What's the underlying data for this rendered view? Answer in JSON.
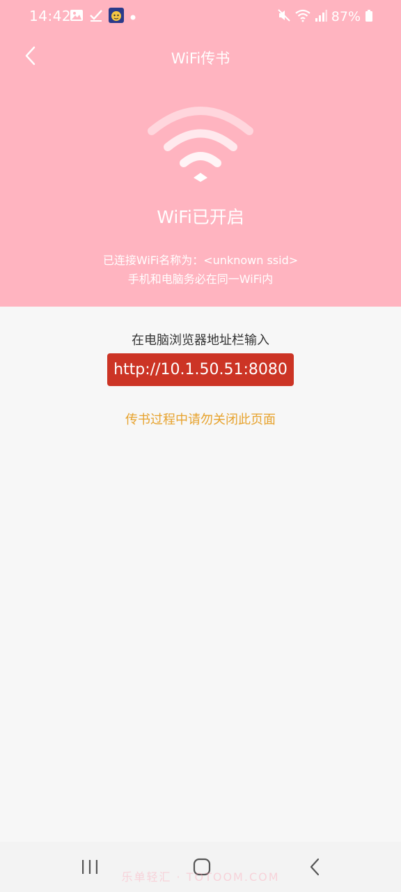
{
  "status_bar": {
    "time": "14:42",
    "battery": "87%",
    "left_icons": [
      "gallery-icon",
      "check-icon",
      "avatar-icon",
      "dot-icon"
    ],
    "right_icons": [
      "mute-icon",
      "wifi-icon",
      "signal-icon",
      "battery-icon"
    ]
  },
  "header": {
    "back_icon": "chevron-left-icon",
    "title": "WiFi传书"
  },
  "wifi_panel": {
    "status": "WiFi已开启",
    "ssid_line": "已连接WiFi名称为：<unknown ssid>",
    "note_line": "手机和电脑务必在同一WiFi内"
  },
  "transfer": {
    "instruction": "在电脑浏览器地址栏输入",
    "url": "http://10.1.50.51:8080",
    "warning": "传书过程中请勿关闭此页面"
  },
  "nav_bar": {
    "buttons": [
      "recent-apps-icon",
      "home-icon",
      "back-icon"
    ],
    "watermark": "乐单轻汇 · TOTOOM.COM"
  },
  "colors": {
    "header_bg": "#ffb4c0",
    "url_bg": "#cc3425",
    "warning": "#e7a22c",
    "page_bg": "#f7f7f7"
  }
}
